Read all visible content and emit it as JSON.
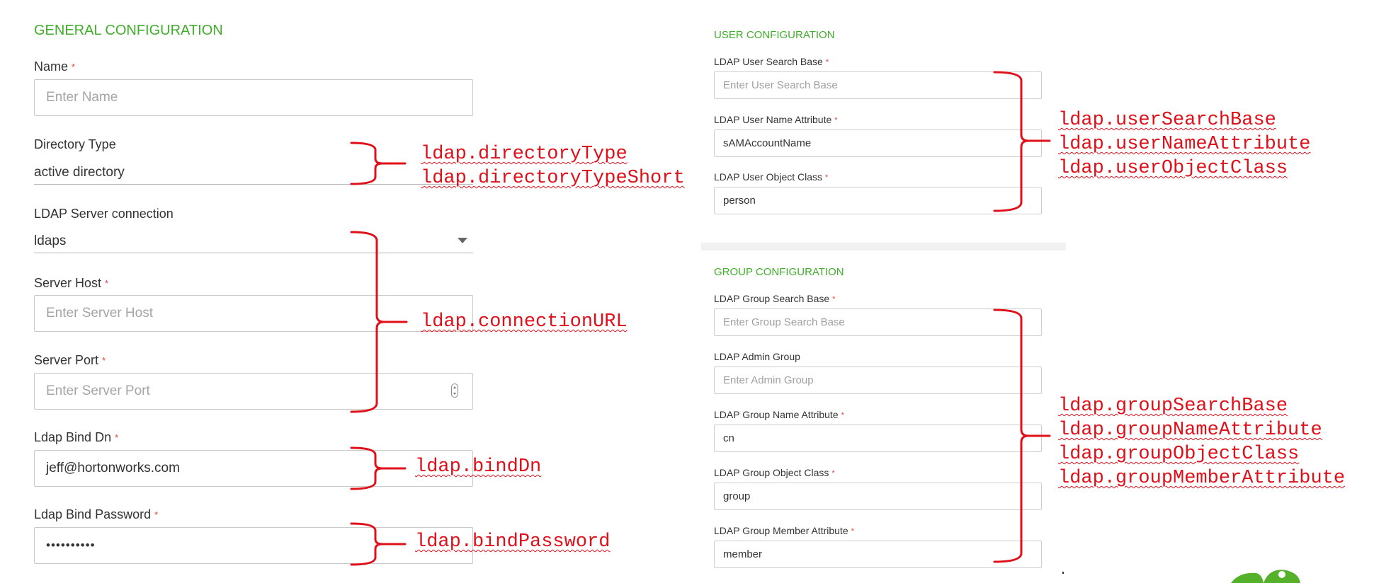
{
  "general": {
    "title": "GENERAL CONFIGURATION",
    "name_label": "Name",
    "name_placeholder": "Enter Name",
    "directory_type_label": "Directory Type",
    "directory_type_value": "active directory",
    "server_connection_label": "LDAP Server connection",
    "server_connection_value": "ldaps",
    "server_host_label": "Server Host",
    "server_host_placeholder": "Enter Server Host",
    "server_port_label": "Server Port",
    "server_port_placeholder": "Enter Server Port",
    "bind_dn_label": "Ldap Bind Dn",
    "bind_dn_value": "jeff@hortonworks.com",
    "bind_password_label": "Ldap Bind Password",
    "bind_password_value": "••••••••••",
    "required_mark": "*"
  },
  "user": {
    "title": "USER CONFIGURATION",
    "search_base_label": "LDAP User Search Base",
    "search_base_placeholder": "Enter User Search Base",
    "name_attribute_label": "LDAP User Name Attribute",
    "name_attribute_value": "sAMAccountName",
    "object_class_label": "LDAP User Object Class",
    "object_class_value": "person"
  },
  "group": {
    "title": "GROUP CONFIGURATION",
    "search_base_label": "LDAP Group Search Base",
    "search_base_placeholder": "Enter Group Search Base",
    "admin_group_label": "LDAP Admin Group",
    "admin_group_placeholder": "Enter Admin Group",
    "name_attribute_label": "LDAP Group Name Attribute",
    "name_attribute_value": "cn",
    "object_class_label": "LDAP Group Object Class",
    "object_class_value": "group",
    "member_attribute_label": "LDAP Group Member Attribute",
    "member_attribute_value": "member"
  },
  "annotations": {
    "directory_type": "ldap.directoryType",
    "directory_type_short": "ldap.directoryTypeShort",
    "connection_url": "ldap.connectionURL",
    "bind_dn": "ldap.bindDn",
    "bind_password": "ldap.bindPassword",
    "user_search_base": "ldap.userSearchBase",
    "user_name_attribute": "ldap.userNameAttribute",
    "user_object_class": "ldap.userObjectClass",
    "group_search_base": "ldap.groupSearchBase",
    "group_name_attribute": "ldap.groupNameAttribute",
    "group_object_class": "ldap.groupObjectClass",
    "group_member_attribute": "ldap.groupMemberAttribute"
  },
  "colors": {
    "section_title": "#3fae2a",
    "required_mark": "#e0423c",
    "annotation": "#e0101a",
    "logo": "#55b02a"
  },
  "icons": {
    "select_caret": "chevron-down-icon",
    "port_stepper": "stepper-icon",
    "logo": "hortonworks-logo"
  }
}
